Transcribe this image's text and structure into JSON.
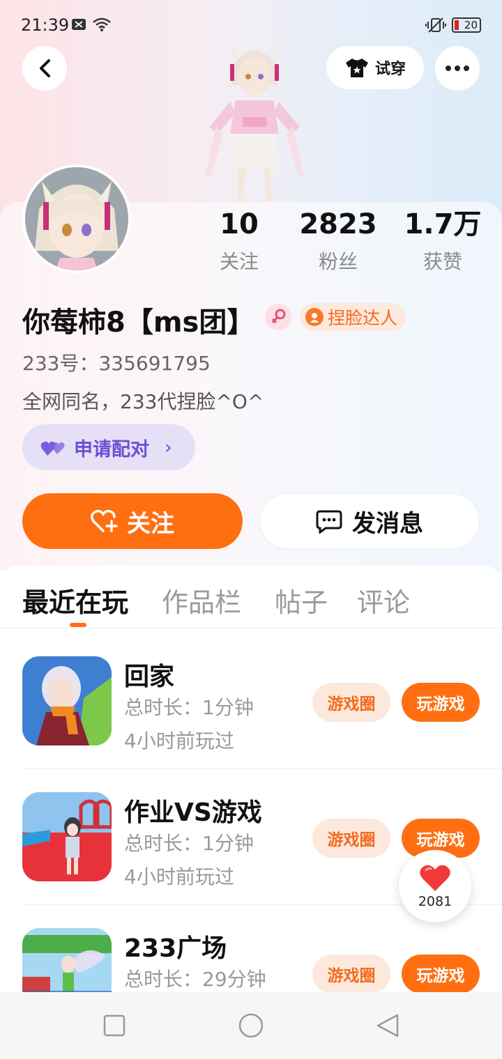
{
  "status_bar": {
    "time": "21:39",
    "battery": "20"
  },
  "header": {
    "tryon_label": "试穿"
  },
  "stats": [
    {
      "num": "10",
      "label": "关注"
    },
    {
      "num": "2823",
      "label": "粉丝"
    },
    {
      "num": "1.7万",
      "label": "获赞"
    }
  ],
  "profile": {
    "name": "你莓柿8【ms团】",
    "badge": "捏脸达人",
    "uid": "233号：335691795",
    "bio": "全网同名，233代捏脸^O^",
    "pair_label": "申请配对"
  },
  "actions": {
    "follow": "关注",
    "message": "发消息"
  },
  "tabs": [
    "最近在玩",
    "作品栏",
    "帖子",
    "评论"
  ],
  "games": [
    {
      "title": "回家",
      "duration": "总时长：1分钟",
      "last_played": "4小时前玩过",
      "circle": "游戏圈",
      "play": "玩游戏"
    },
    {
      "title": "作业VS游戏",
      "duration": "总时长：1分钟",
      "last_played": "4小时前玩过",
      "circle": "游戏圈",
      "play": "玩游戏"
    },
    {
      "title": "233广场",
      "duration": "总时长：29分钟",
      "last_played": "",
      "circle": "游戏圈",
      "play": "玩游戏"
    }
  ],
  "floating_like": {
    "count": "2081"
  },
  "colors": {
    "accent": "#ff6f12",
    "pair": "#6b4fd6"
  }
}
